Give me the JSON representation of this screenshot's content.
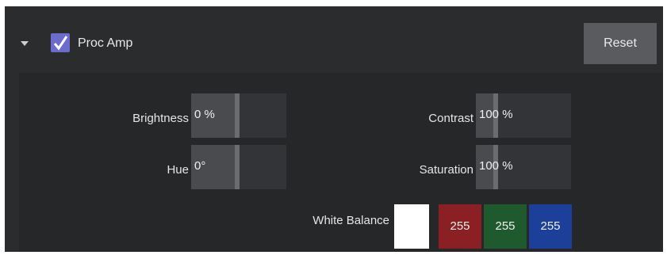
{
  "header": {
    "title": "Proc Amp",
    "enabled": true,
    "reset_label": "Reset"
  },
  "controls": {
    "brightness": {
      "label": "Brightness",
      "value": "0",
      "unit": "%",
      "level": 0.5
    },
    "contrast": {
      "label": "Contrast",
      "value": "100",
      "unit": "%",
      "level": 0.25
    },
    "hue": {
      "label": "Hue",
      "value": "0°",
      "level": 0.5
    },
    "saturation": {
      "label": "Saturation",
      "value": "100",
      "unit": "%",
      "level": 0.25
    }
  },
  "white_balance": {
    "label": "White Balance",
    "swatch_color": "#ffffff",
    "red": {
      "value": "255",
      "color": "#8a1f24"
    },
    "green": {
      "value": "255",
      "color": "#1f5a2e"
    },
    "blue": {
      "value": "255",
      "color": "#1c3f9a"
    }
  },
  "colors": {
    "checkbox_accent": "#6c6ccc",
    "panel_bg": "#2b2c2e"
  }
}
